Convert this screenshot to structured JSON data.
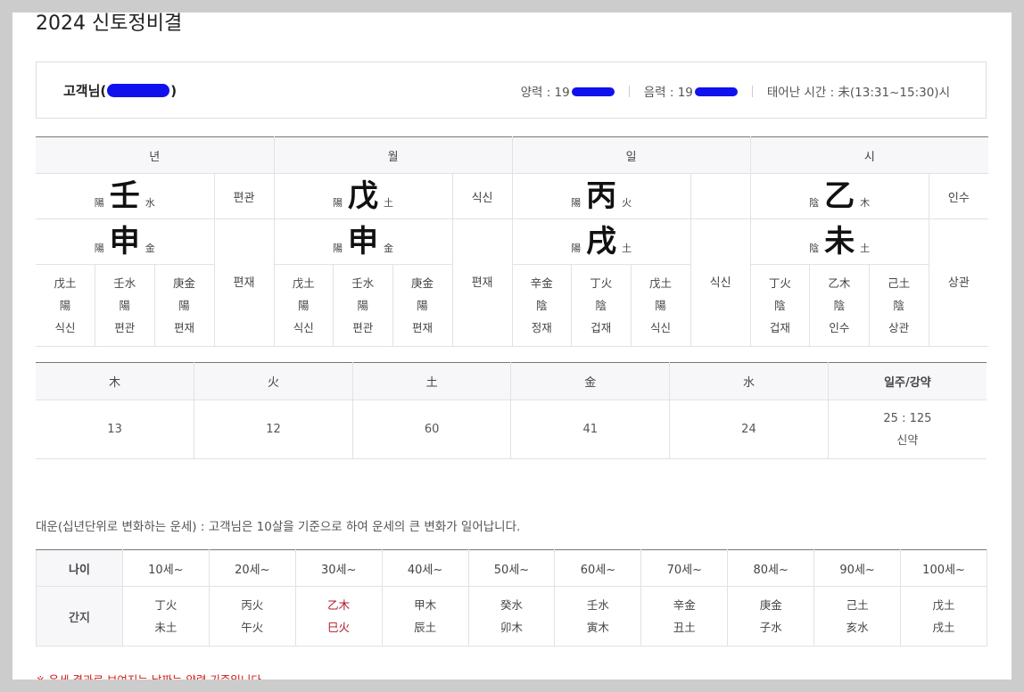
{
  "title": "2024 신토정비결",
  "customer": {
    "name_prefix": "고객님(",
    "name_suffix": ")",
    "solar_label": "양력 : 19",
    "lunar_label": "음력 : 19",
    "birth_time": "태어난 시간 : 未(13:31~15:30)시"
  },
  "pillars": [
    {
      "header": "년",
      "stem": {
        "yy": "陽",
        "char": "壬",
        "el": "水",
        "tengod": "편관"
      },
      "branch": {
        "yy": "陽",
        "char": "申",
        "el": "金",
        "tengod": "편재"
      },
      "hidden": [
        {
          "char": "戊土",
          "yy": "陽",
          "god": "식신"
        },
        {
          "char": "壬水",
          "yy": "陽",
          "god": "편관"
        },
        {
          "char": "庚金",
          "yy": "陽",
          "god": "편재"
        }
      ]
    },
    {
      "header": "월",
      "stem": {
        "yy": "陽",
        "char": "戊",
        "el": "土",
        "tengod": "식신"
      },
      "branch": {
        "yy": "陽",
        "char": "申",
        "el": "金",
        "tengod": "편재"
      },
      "hidden": [
        {
          "char": "戊土",
          "yy": "陽",
          "god": "식신"
        },
        {
          "char": "壬水",
          "yy": "陽",
          "god": "편관"
        },
        {
          "char": "庚金",
          "yy": "陽",
          "god": "편재"
        }
      ]
    },
    {
      "header": "일",
      "stem": {
        "yy": "陽",
        "char": "丙",
        "el": "火",
        "tengod": ""
      },
      "branch": {
        "yy": "陽",
        "char": "戌",
        "el": "土",
        "tengod": "식신"
      },
      "hidden": [
        {
          "char": "辛金",
          "yy": "陰",
          "god": "정재"
        },
        {
          "char": "丁火",
          "yy": "陰",
          "god": "겁재"
        },
        {
          "char": "戊土",
          "yy": "陽",
          "god": "식신"
        }
      ]
    },
    {
      "header": "시",
      "stem": {
        "yy": "陰",
        "char": "乙",
        "el": "木",
        "tengod": "인수"
      },
      "branch": {
        "yy": "陰",
        "char": "未",
        "el": "土",
        "tengod": "상관"
      },
      "hidden": [
        {
          "char": "丁火",
          "yy": "陰",
          "god": "겁재"
        },
        {
          "char": "乙木",
          "yy": "陰",
          "god": "인수"
        },
        {
          "char": "己土",
          "yy": "陰",
          "god": "상관"
        }
      ]
    }
  ],
  "elements": {
    "headers": [
      "木",
      "火",
      "土",
      "金",
      "水",
      "일주/강약"
    ],
    "values": [
      "13",
      "12",
      "60",
      "41",
      "24"
    ],
    "strength_ratio": "25 : 125",
    "strength_label": "신약"
  },
  "daeun_description": "대운(십년단위로 변화하는 운세) : 고객님은 10살을 기준으로 하여 운세의 큰 변화가 일어납니다.",
  "daeun": {
    "age_label": "나이",
    "ganji_label": "간지",
    "columns": [
      {
        "age": "10세~",
        "stem": "丁火",
        "branch": "未土",
        "highlight": false
      },
      {
        "age": "20세~",
        "stem": "丙火",
        "branch": "午火",
        "highlight": false
      },
      {
        "age": "30세~",
        "stem": "乙木",
        "branch": "巳火",
        "highlight": true
      },
      {
        "age": "40세~",
        "stem": "甲木",
        "branch": "辰土",
        "highlight": false
      },
      {
        "age": "50세~",
        "stem": "癸水",
        "branch": "卯木",
        "highlight": false
      },
      {
        "age": "60세~",
        "stem": "壬水",
        "branch": "寅木",
        "highlight": false
      },
      {
        "age": "70세~",
        "stem": "辛金",
        "branch": "丑土",
        "highlight": false
      },
      {
        "age": "80세~",
        "stem": "庚金",
        "branch": "子水",
        "highlight": false
      },
      {
        "age": "90세~",
        "stem": "己土",
        "branch": "亥水",
        "highlight": false
      },
      {
        "age": "100세~",
        "stem": "戊土",
        "branch": "戌土",
        "highlight": false
      }
    ]
  },
  "note": "※ 운세 결과로 보여지는 날짜는 양력 기준입니다.",
  "colors": {
    "highlight": "#b0142a",
    "note": "#d01818",
    "mask": "#1111ee"
  }
}
